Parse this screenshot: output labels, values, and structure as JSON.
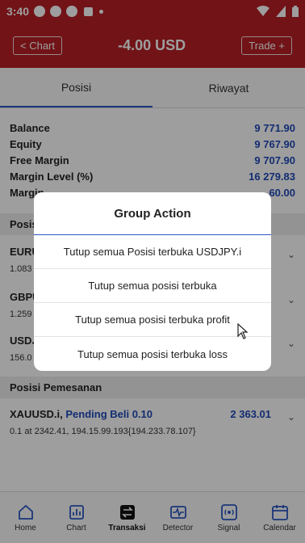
{
  "status_bar": {
    "time": "3:40"
  },
  "header": {
    "back_label": "< Chart",
    "title": "-4.00 USD",
    "trade_label": "Trade +"
  },
  "tabs": [
    {
      "label": "Posisi"
    },
    {
      "label": "Riwayat"
    }
  ],
  "summary": [
    {
      "label": "Balance",
      "value": "9 771.90"
    },
    {
      "label": "Equity",
      "value": "9 767.90"
    },
    {
      "label": "Free Margin",
      "value": "9 707.90"
    },
    {
      "label": "Margin Level (%)",
      "value": "16 279.83"
    },
    {
      "label": "Margin",
      "value": "60.00"
    }
  ],
  "positions_header": "Posis",
  "positions": [
    {
      "symbol": "EURU",
      "detail": "1.083"
    },
    {
      "symbol": "GBPU",
      "detail": "1.259"
    },
    {
      "symbol": "USDJ",
      "detail": "156.0"
    }
  ],
  "orders_header": "Posisi Pemesanan",
  "order": {
    "symbol": "XAUUSD.i,",
    "type": "Pending Beli 0.10",
    "value": "2 363.01",
    "detail": "0.1 at 2342.41, 194.15.99.193{194.233.78.107}"
  },
  "bottom_nav": [
    {
      "label": "Home",
      "icon": "home-icon"
    },
    {
      "label": "Chart",
      "icon": "chart-icon"
    },
    {
      "label": "Transaksi",
      "icon": "transaction-icon"
    },
    {
      "label": "Detector",
      "icon": "detector-icon"
    },
    {
      "label": "Signal",
      "icon": "signal-icon"
    },
    {
      "label": "Calendar",
      "icon": "calendar-icon"
    }
  ],
  "dialog": {
    "title": "Group Action",
    "options": [
      "Tutup semua Posisi terbuka USDJPY.i",
      "Tutup semua posisi terbuka",
      "Tutup semua posisi terbuka profit",
      "Tutup semua posisi terbuka loss"
    ]
  },
  "colors": {
    "brand": "#b61f26",
    "accent": "#1f49b8"
  }
}
